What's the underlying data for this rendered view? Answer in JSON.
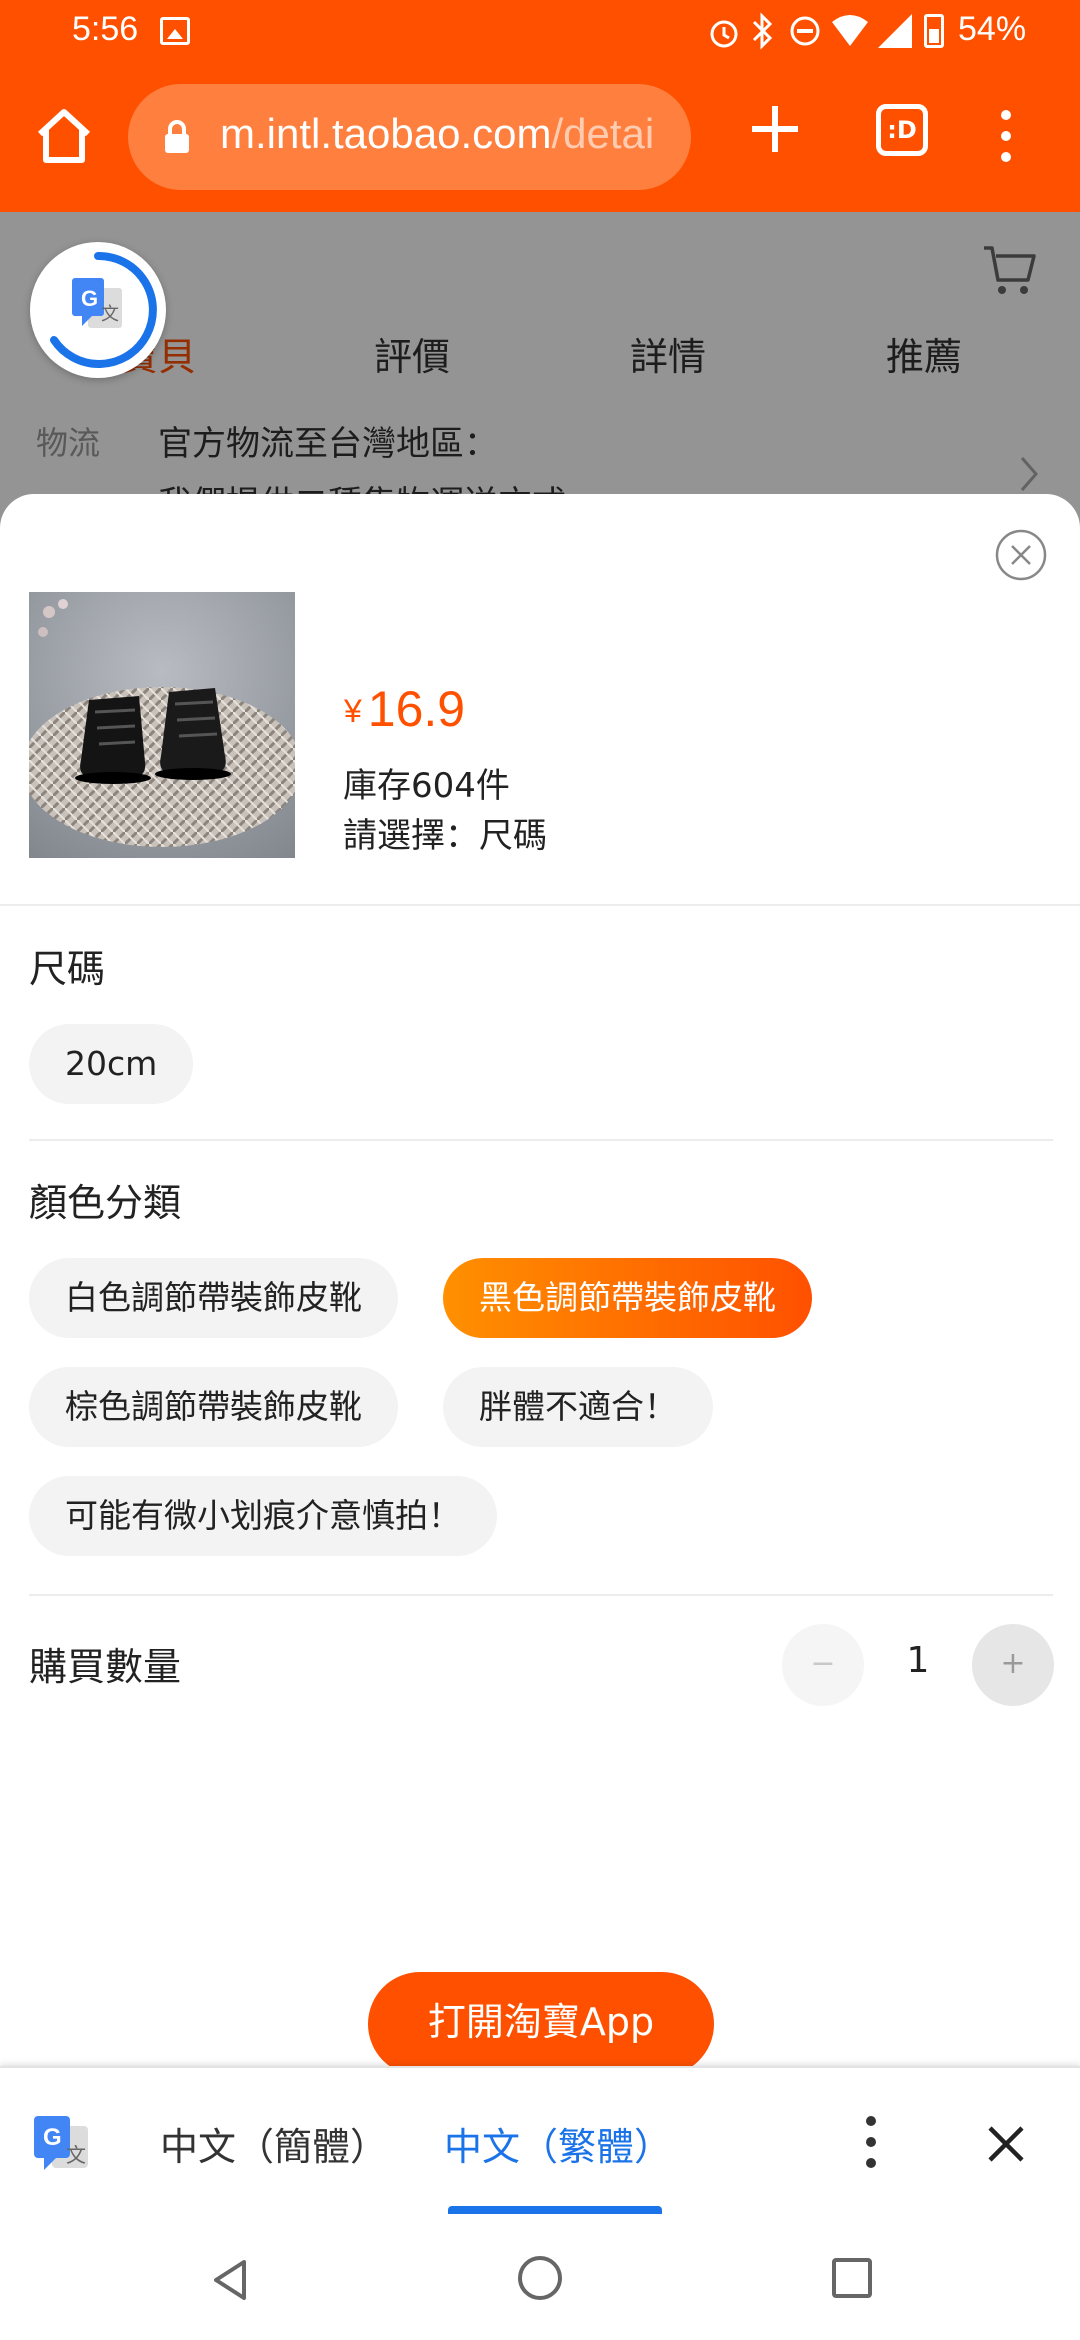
{
  "status_bar": {
    "time": "5:56",
    "battery": "54%",
    "icons": [
      "gallery-icon",
      "alarm-icon",
      "bluetooth-icon",
      "dnd-icon",
      "wifi-icon",
      "signal-icon",
      "battery-icon"
    ]
  },
  "browser": {
    "url_main": "m.intl.taobao.com",
    "url_rest": "/detai",
    "tabs_label": ":D"
  },
  "page": {
    "tabs": [
      "寶貝",
      "評價",
      "詳情",
      "推薦"
    ],
    "shipping_label": "物流",
    "shipping_text": "官方物流至台灣地區：",
    "shipping_text2": "我們提供二種集物運送方式"
  },
  "sheet": {
    "price_symbol": "¥",
    "price": "16.9",
    "stock": "庫存604件",
    "select_hint": "請選擇：尺碼",
    "size_title": "尺碼",
    "sizes": [
      "20cm"
    ],
    "color_title": "顏色分類",
    "colors": [
      "白色調節帶裝飾皮靴",
      "黑色調節帶裝飾皮靴",
      "棕色調節帶裝飾皮靴",
      "胖體不適合！",
      "可能有微小划痕介意慎拍！"
    ],
    "selected_color": "黑色調節帶裝飾皮靴",
    "qty_title": "購買數量",
    "qty_minus": "−",
    "qty_value": "1",
    "qty_plus": "+"
  },
  "open_app": "打開淘寶App",
  "translate_bar": {
    "lang_source": "中文（簡體）",
    "lang_target": "中文（繁體）"
  },
  "colors": {
    "brand": "#ff5000",
    "accent_blue": "#1a73e8"
  }
}
